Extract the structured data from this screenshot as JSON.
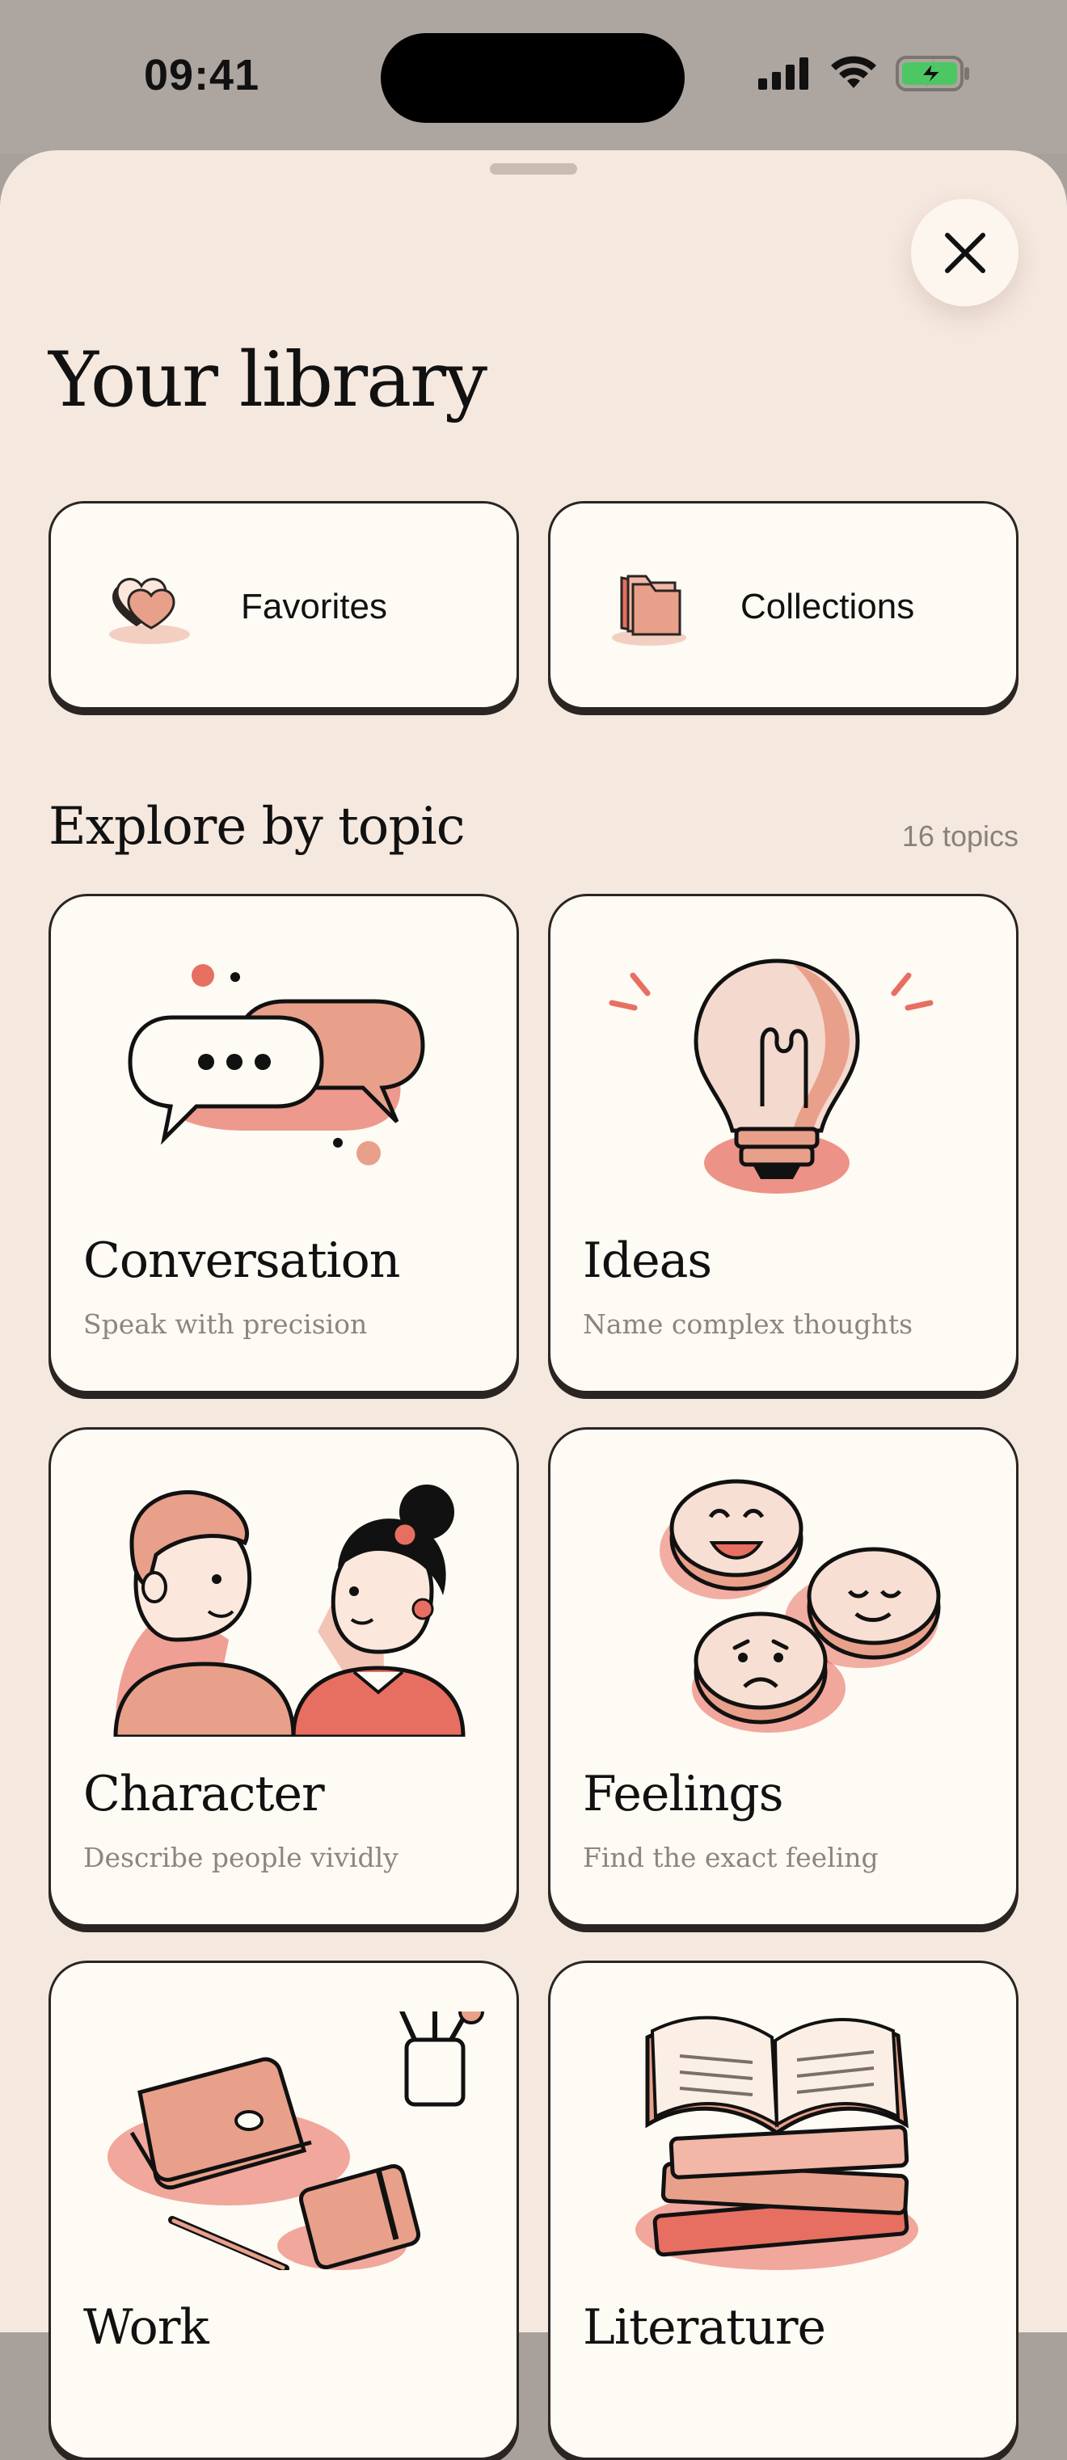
{
  "status_bar": {
    "time": "09:41"
  },
  "header": {
    "title": "Your library"
  },
  "shortcuts": [
    {
      "label": "Favorites",
      "icon": "heart-box-icon"
    },
    {
      "label": "Collections",
      "icon": "folders-icon"
    }
  ],
  "explore": {
    "heading": "Explore by topic",
    "count": "16 topics",
    "topics": [
      {
        "name": "Conversation",
        "subtitle": "Speak with precision",
        "icon": "speech-bubbles-icon"
      },
      {
        "name": "Ideas",
        "subtitle": "Name complex thoughts",
        "icon": "lightbulb-icon"
      },
      {
        "name": "Character",
        "subtitle": "Describe people vividly",
        "icon": "two-people-icon"
      },
      {
        "name": "Feelings",
        "subtitle": "Find the exact feeling",
        "icon": "faces-icon"
      },
      {
        "name": "Work",
        "subtitle": "",
        "icon": "laptop-desk-icon"
      },
      {
        "name": "Literature",
        "subtitle": "",
        "icon": "books-icon"
      }
    ]
  },
  "colors": {
    "sheet_bg": "#f5e8df",
    "card_bg": "#fefaf4",
    "accent_coral": "#e8a08a",
    "accent_red": "#e76f61",
    "ink": "#2a2522"
  }
}
